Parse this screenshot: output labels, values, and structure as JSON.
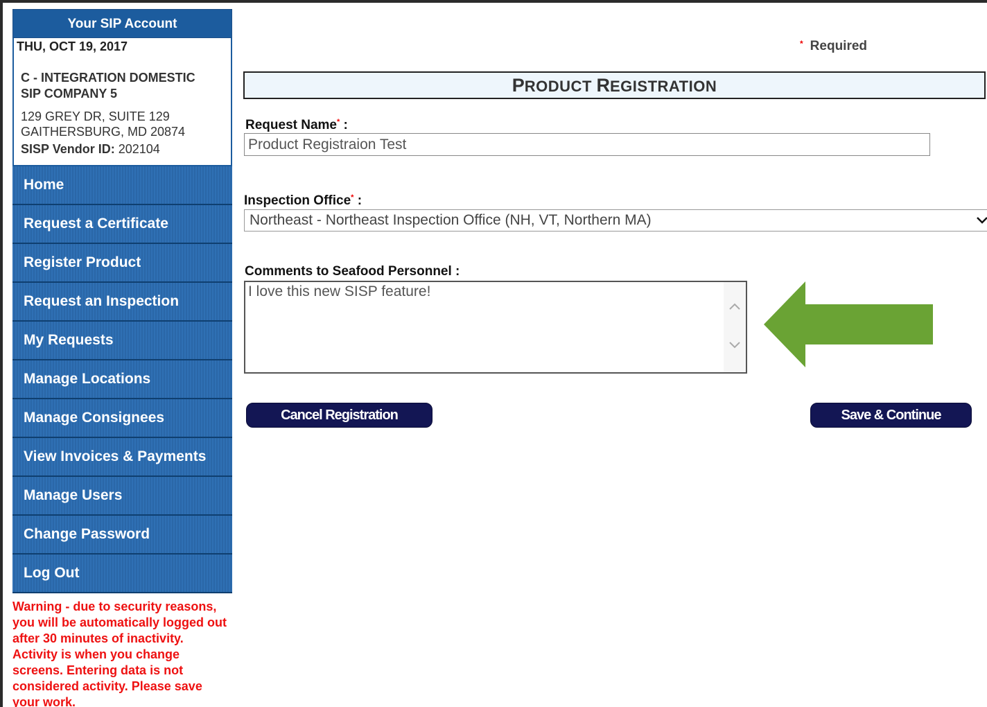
{
  "account": {
    "title": "Your SIP Account",
    "date": "THU, OCT 19, 2017",
    "company_line1": "C - INTEGRATION DOMESTIC",
    "company_line2": "SIP COMPANY 5",
    "address_line1": "129 GREY DR, SUITE 129",
    "address_line2": "GAITHERSBURG, MD 20874",
    "vendor_label": "SISP Vendor ID:",
    "vendor_id": "202104"
  },
  "nav": {
    "items": [
      {
        "label": "Home"
      },
      {
        "label": "Request a Certificate"
      },
      {
        "label": "Register Product"
      },
      {
        "label": "Request an Inspection"
      },
      {
        "label": "My Requests"
      },
      {
        "label": "Manage Locations"
      },
      {
        "label": "Manage Consignees"
      },
      {
        "label": "View Invoices & Payments"
      },
      {
        "label": "Manage Users"
      },
      {
        "label": "Change Password"
      },
      {
        "label": "Log Out"
      }
    ]
  },
  "warning": "Warning - due to security reasons, you will be automatically logged out after 30 minutes of inactivity. Activity is when you change screens. Entering data is not considered activity. Please save your work.",
  "form": {
    "required_marker": "*",
    "required_label": "Required",
    "section_title_cap1": "P",
    "section_title_rest1": "RODUCT ",
    "section_title_cap2": "R",
    "section_title_rest2": "EGISTRATION",
    "request_name_label": "Request Name",
    "request_name_value": "Product Registraion Test",
    "inspection_office_label": "Inspection Office",
    "inspection_office_value": "Northeast - Northeast Inspection Office (NH, VT, Northern MA)",
    "comments_label": "Comments to Seafood Personnel :",
    "comments_value": "I love this new SISP feature!",
    "label_suffix": " :",
    "cancel_label": "Cancel Registration",
    "save_label": "Save & Continue"
  },
  "colors": {
    "nav_blue": "#2f70b4",
    "header_blue": "#1c5c9e",
    "button_navy": "#131654",
    "warning_red": "#ee1111",
    "arrow_green": "#6aa334"
  },
  "icons": {
    "select_chevron": "chevron-down-icon",
    "scroll_up": "chevron-up-icon",
    "scroll_down": "chevron-down-icon",
    "annotation": "arrow-left-icon"
  }
}
